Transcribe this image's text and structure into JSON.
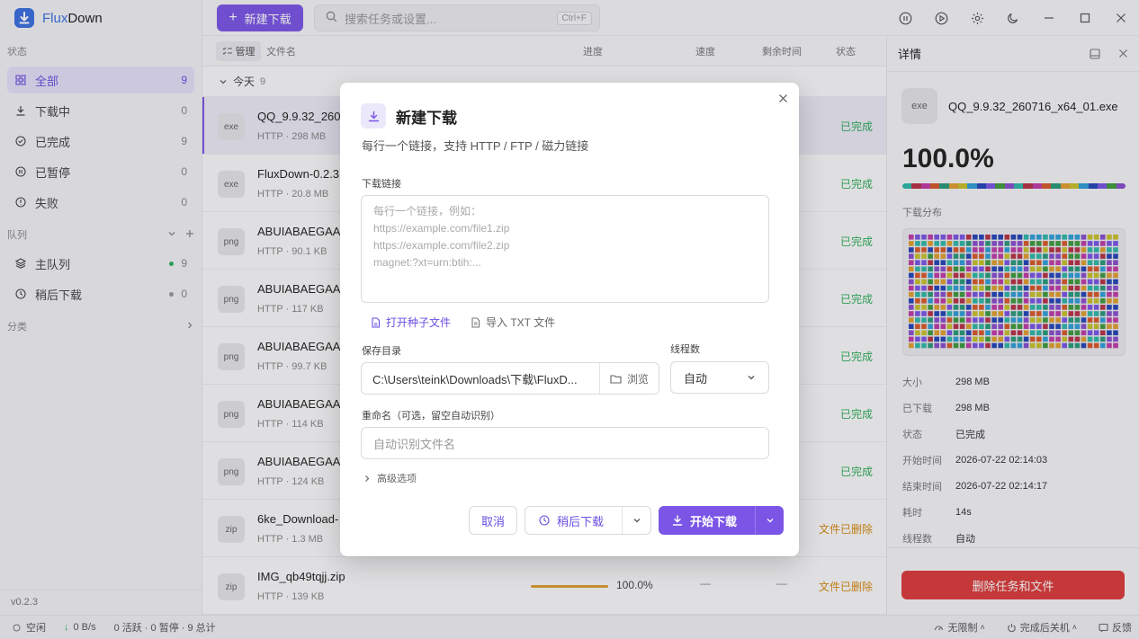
{
  "app": {
    "name_part1": "Flux",
    "name_part2": "Down",
    "accent": "#7b55e6",
    "version": "v0.2.3"
  },
  "sidebar": {
    "status_header": "状态",
    "status_items": [
      {
        "label": "全部",
        "count": "9",
        "icon": "grid-icon"
      },
      {
        "label": "下载中",
        "count": "0",
        "icon": "download-icon"
      },
      {
        "label": "已完成",
        "count": "9",
        "icon": "check-circle-icon"
      },
      {
        "label": "已暂停",
        "count": "0",
        "icon": "pause-circle-icon"
      },
      {
        "label": "失败",
        "count": "0",
        "icon": "alert-circle-icon"
      }
    ],
    "queue_header": "队列",
    "queue_items": [
      {
        "label": "主队列",
        "count": "9",
        "icon": "layers-icon",
        "dot_color": "#2fae5a"
      },
      {
        "label": "稍后下载",
        "count": "0",
        "icon": "clock-icon",
        "dot_color": "#999999"
      }
    ],
    "category_header": "分类"
  },
  "toolbar": {
    "new_download_label": "新建下载",
    "search_placeholder": "搜索任务或设置...",
    "search_shortcut": "Ctrl+F"
  },
  "list": {
    "manage_label": "管理",
    "columns": {
      "name": "文件名",
      "progress": "进度",
      "speed": "速度",
      "remaining": "剩余时间",
      "status": "状态"
    },
    "group": {
      "label": "今天",
      "count": "9"
    },
    "rows": [
      {
        "ext": "exe",
        "name": "QQ_9.9.32_2607",
        "meta": "HTTP · 298 MB",
        "status": "已完成"
      },
      {
        "ext": "exe",
        "name": "FluxDown-0.2.3",
        "meta": "HTTP · 20.8 MB",
        "status": "已完成"
      },
      {
        "ext": "png",
        "name": "ABUIABAEGAA",
        "meta": "HTTP · 90.1 KB",
        "status": "已完成"
      },
      {
        "ext": "png",
        "name": "ABUIABAEGAA",
        "meta": "HTTP · 117 KB",
        "status": "已完成"
      },
      {
        "ext": "png",
        "name": "ABUIABAEGAA",
        "meta": "HTTP · 99.7 KB",
        "status": "已完成"
      },
      {
        "ext": "png",
        "name": "ABUIABAEGAA",
        "meta": "HTTP · 114 KB",
        "status": "已完成"
      },
      {
        "ext": "png",
        "name": "ABUIABAEGAA",
        "meta": "HTTP · 124 KB",
        "status": "已完成"
      },
      {
        "ext": "zip",
        "name": "6ke_Download-",
        "meta": "HTTP · 1.3 MB",
        "status": "文件已删除"
      },
      {
        "ext": "zip",
        "name": "IMG_qb49tqjj.zip",
        "meta": "HTTP · 139 KB",
        "status": "文件已删除",
        "progress_text": "100.0%",
        "progress": 1.0,
        "speed": "—",
        "remaining": "—"
      }
    ]
  },
  "details": {
    "title": "详情",
    "ext": "exe",
    "file_name": "QQ_9.9.32_260716_x64_01.exe",
    "percent": "100.0%",
    "distribution_label": "下载分布",
    "fields": [
      {
        "key": "大小",
        "value": "298 MB"
      },
      {
        "key": "已下载",
        "value": "298 MB"
      },
      {
        "key": "状态",
        "value": "已完成"
      },
      {
        "key": "开始时间",
        "value": "2026-07-22 02:14:03"
      },
      {
        "key": "结束时间",
        "value": "2026-07-22 02:14:17"
      },
      {
        "key": "耗时",
        "value": "14s"
      },
      {
        "key": "线程数",
        "value": "自动"
      }
    ],
    "delete_label": "删除任务和文件",
    "segment_colors": [
      "#7b55e6",
      "#c23ba8",
      "#2f9fd8",
      "#2fb8a8",
      "#e0a030",
      "#3f9b3f",
      "#d85a2a",
      "#2546b8",
      "#b83248",
      "#c8c22a",
      "#8a4fcf",
      "#2a9a7a"
    ]
  },
  "statusbar": {
    "state": "空闲",
    "speed": "0 B/s",
    "summary": "0 活跃 · 0 暂停 · 9 总计",
    "limit": "无限制",
    "after_complete": "完成后关机",
    "feedback": "反馈"
  },
  "modal": {
    "title": "新建下载",
    "description": "每行一个链接，支持 HTTP / FTP / 磁力链接",
    "links_label": "下载链接",
    "links_placeholder_lines": [
      "每行一个链接，例如：",
      "https://example.com/file1.zip",
      "https://example.com/file2.zip",
      "magnet:?xt=urn:btih:..."
    ],
    "open_torrent": "打开种子文件",
    "import_txt": "导入 TXT 文件",
    "save_dir_label": "保存目录",
    "save_dir_value": "C:\\Users\\teink\\Downloads\\下载\\FluxD...",
    "browse_label": "浏览",
    "threads_label": "线程数",
    "threads_value": "自动",
    "rename_label": "重命名（可选，留空自动识别）",
    "rename_placeholder": "自动识别文件名",
    "advanced_label": "高级选项",
    "cancel_label": "取消",
    "later_label": "稍后下载",
    "start_label": "开始下载"
  }
}
